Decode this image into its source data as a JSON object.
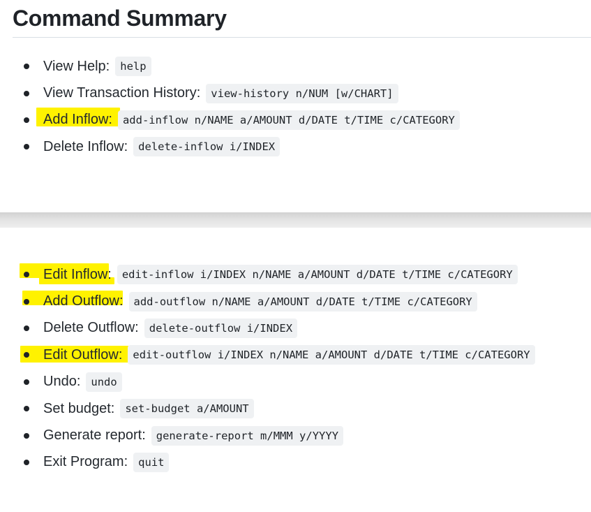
{
  "title": "Command Summary",
  "commands_top": [
    {
      "label": "View Help:",
      "code": "help"
    },
    {
      "label": "View Transaction History:",
      "code": "view-history n/NUM [w/CHART]"
    },
    {
      "label": "Add Inflow:",
      "code": "add-inflow n/NAME a/AMOUNT d/DATE t/TIME c/CATEGORY",
      "highlighted": true
    },
    {
      "label": "Delete Inflow:",
      "code": "delete-inflow i/INDEX"
    }
  ],
  "commands_bottom": [
    {
      "label": "Edit Inflow:",
      "code": "edit-inflow i/INDEX n/NAME a/AMOUNT d/DATE t/TIME c/CATEGORY",
      "highlighted": true
    },
    {
      "label": "Add Outflow:",
      "code": "add-outflow n/NAME a/AMOUNT d/DATE t/TIME c/CATEGORY",
      "highlighted": true
    },
    {
      "label": "Delete Outflow:",
      "code": "delete-outflow i/INDEX"
    },
    {
      "label": "Edit Outflow:",
      "code": "edit-outflow i/INDEX n/NAME a/AMOUNT d/DATE t/TIME c/CATEGORY",
      "highlighted": true
    },
    {
      "label": "Undo:",
      "code": "undo"
    },
    {
      "label": "Set budget:",
      "code": "set-budget a/AMOUNT"
    },
    {
      "label": "Generate report:",
      "code": "generate-report m/MMM y/YYYY"
    },
    {
      "label": "Exit Program:",
      "code": "quit"
    }
  ],
  "colors": {
    "highlight": "#fff200",
    "code_background": "#eff1f3",
    "text": "#1f2328"
  }
}
